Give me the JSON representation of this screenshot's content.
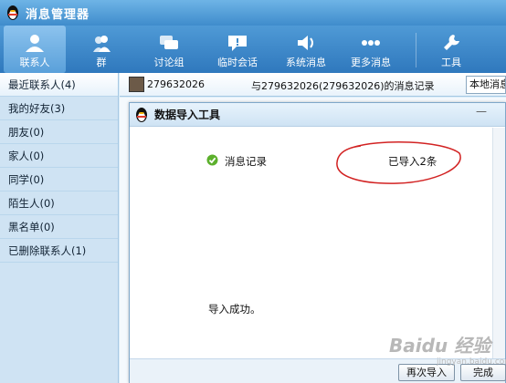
{
  "window": {
    "title": "消息管理器"
  },
  "toolbar": {
    "items": [
      {
        "label": "联系人",
        "icon": "person-icon"
      },
      {
        "label": "群",
        "icon": "group-icon"
      },
      {
        "label": "讨论组",
        "icon": "discussion-icon"
      },
      {
        "label": "临时会话",
        "icon": "temp-chat-icon"
      },
      {
        "label": "系统消息",
        "icon": "speaker-icon"
      },
      {
        "label": "更多消息",
        "icon": "more-dots-icon"
      },
      {
        "label": "工具",
        "icon": "wrench-icon"
      }
    ]
  },
  "sidebar": {
    "items": [
      {
        "label": "最近联系人(4)"
      },
      {
        "label": "我的好友(3)"
      },
      {
        "label": "朋友(0)"
      },
      {
        "label": "家人(0)"
      },
      {
        "label": "同学(0)"
      },
      {
        "label": "陌生人(0)"
      },
      {
        "label": "黑名单(0)"
      },
      {
        "label": "已删除联系人(1)"
      }
    ]
  },
  "header": {
    "contact_id": "279632026",
    "description": "与279632026(279632026)的消息记录",
    "local_button": "本地消息"
  },
  "dialog": {
    "title": "数据导入工具",
    "record_label": "消息记录",
    "imported_text": "已导入2条",
    "success_text": "导入成功。",
    "reimport_button": "再次导入",
    "done_button": "完成"
  },
  "watermark": {
    "text": "Baidu 经验",
    "sub": "jingyan.baidu.com"
  },
  "colors": {
    "toolbar": "#3f8ccc",
    "sidebar": "#cfe3f3",
    "annotation": "#d22222"
  }
}
